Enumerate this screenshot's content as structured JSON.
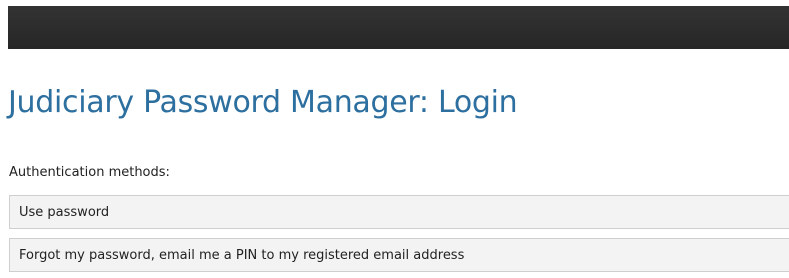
{
  "page": {
    "title": "Judiciary Password Manager: Login"
  },
  "authentication": {
    "label": "Authentication methods:",
    "methods": [
      {
        "label": "Use password"
      },
      {
        "label": "Forgot my password, email me a PIN to my registered email address"
      }
    ]
  },
  "colors": {
    "title": "#2d6f9f",
    "top_bar": "#2b2b2b",
    "list_item_background": "#f3f3f3",
    "list_item_border": "#cfcfcf"
  }
}
